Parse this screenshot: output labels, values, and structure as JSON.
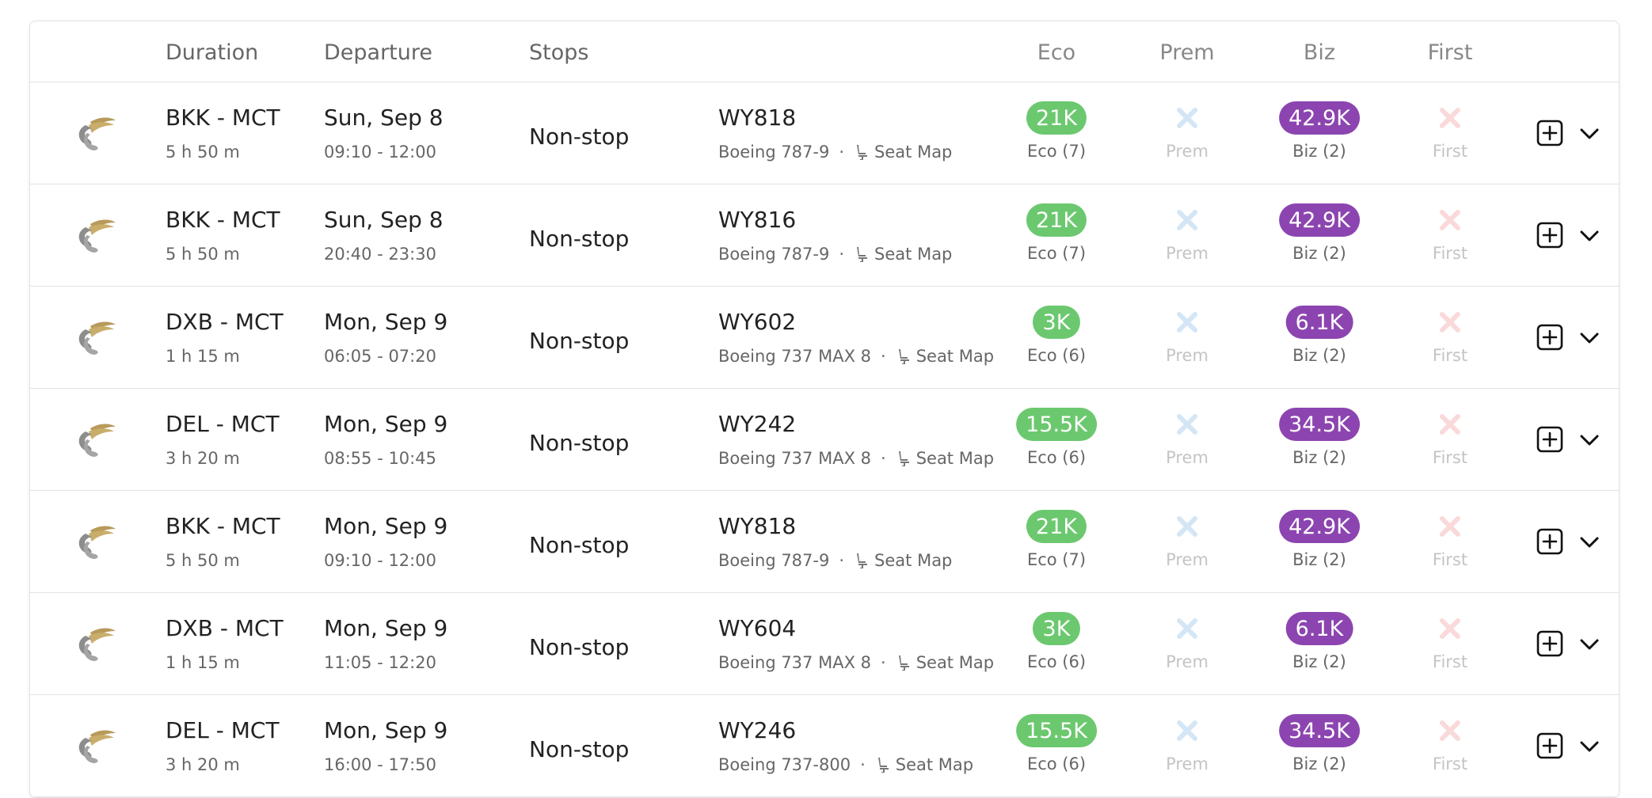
{
  "columns": {
    "duration": "Duration",
    "departure": "Departure",
    "stops": "Stops",
    "eco": "Eco",
    "prem": "Prem",
    "biz": "Biz",
    "first": "First"
  },
  "colors": {
    "eco_pill": "#6bc86e",
    "biz_pill": "#8c45b0",
    "prem_x": "#d4e6f5",
    "first_x": "#f9d9d9",
    "logo_gold": "#b89a5a",
    "logo_gray": "#8d8d8d"
  },
  "icons": {
    "airline_logo": "oman-air-logo",
    "seat": "seat-icon",
    "unavailable": "x-icon",
    "add": "plus-square-icon",
    "expand": "chevron-down-icon"
  },
  "separator": "·",
  "seat_map_label": "Seat Map",
  "rows": [
    {
      "route": "BKK - MCT",
      "duration": "5 h 50 m",
      "date": "Sun, Sep 8",
      "time": "09:10 - 12:00",
      "stops": "Non-stop",
      "flight": "WY818",
      "aircraft": "Boeing 787-9",
      "eco": {
        "price": "21K",
        "label": "Eco (7)"
      },
      "prem": {
        "label": "Prem"
      },
      "biz": {
        "price": "42.9K",
        "label": "Biz (2)"
      },
      "first": {
        "label": "First"
      }
    },
    {
      "route": "BKK - MCT",
      "duration": "5 h 50 m",
      "date": "Sun, Sep 8",
      "time": "20:40 - 23:30",
      "stops": "Non-stop",
      "flight": "WY816",
      "aircraft": "Boeing 787-9",
      "eco": {
        "price": "21K",
        "label": "Eco (7)"
      },
      "prem": {
        "label": "Prem"
      },
      "biz": {
        "price": "42.9K",
        "label": "Biz (2)"
      },
      "first": {
        "label": "First"
      }
    },
    {
      "route": "DXB - MCT",
      "duration": "1 h 15 m",
      "date": "Mon, Sep 9",
      "time": "06:05 - 07:20",
      "stops": "Non-stop",
      "flight": "WY602",
      "aircraft": "Boeing 737 MAX 8",
      "eco": {
        "price": "3K",
        "label": "Eco (6)"
      },
      "prem": {
        "label": "Prem"
      },
      "biz": {
        "price": "6.1K",
        "label": "Biz (2)"
      },
      "first": {
        "label": "First"
      }
    },
    {
      "route": "DEL - MCT",
      "duration": "3 h 20 m",
      "date": "Mon, Sep 9",
      "time": "08:55 - 10:45",
      "stops": "Non-stop",
      "flight": "WY242",
      "aircraft": "Boeing 737 MAX 8",
      "eco": {
        "price": "15.5K",
        "label": "Eco (6)"
      },
      "prem": {
        "label": "Prem"
      },
      "biz": {
        "price": "34.5K",
        "label": "Biz (2)"
      },
      "first": {
        "label": "First"
      }
    },
    {
      "route": "BKK - MCT",
      "duration": "5 h 50 m",
      "date": "Mon, Sep 9",
      "time": "09:10 - 12:00",
      "stops": "Non-stop",
      "flight": "WY818",
      "aircraft": "Boeing 787-9",
      "eco": {
        "price": "21K",
        "label": "Eco (7)"
      },
      "prem": {
        "label": "Prem"
      },
      "biz": {
        "price": "42.9K",
        "label": "Biz (2)"
      },
      "first": {
        "label": "First"
      }
    },
    {
      "route": "DXB - MCT",
      "duration": "1 h 15 m",
      "date": "Mon, Sep 9",
      "time": "11:05 - 12:20",
      "stops": "Non-stop",
      "flight": "WY604",
      "aircraft": "Boeing 737 MAX 8",
      "eco": {
        "price": "3K",
        "label": "Eco (6)"
      },
      "prem": {
        "label": "Prem"
      },
      "biz": {
        "price": "6.1K",
        "label": "Biz (2)"
      },
      "first": {
        "label": "First"
      }
    },
    {
      "route": "DEL - MCT",
      "duration": "3 h 20 m",
      "date": "Mon, Sep 9",
      "time": "16:00 - 17:50",
      "stops": "Non-stop",
      "flight": "WY246",
      "aircraft": "Boeing 737-800",
      "eco": {
        "price": "15.5K",
        "label": "Eco (6)"
      },
      "prem": {
        "label": "Prem"
      },
      "biz": {
        "price": "34.5K",
        "label": "Biz (2)"
      },
      "first": {
        "label": "First"
      }
    }
  ]
}
